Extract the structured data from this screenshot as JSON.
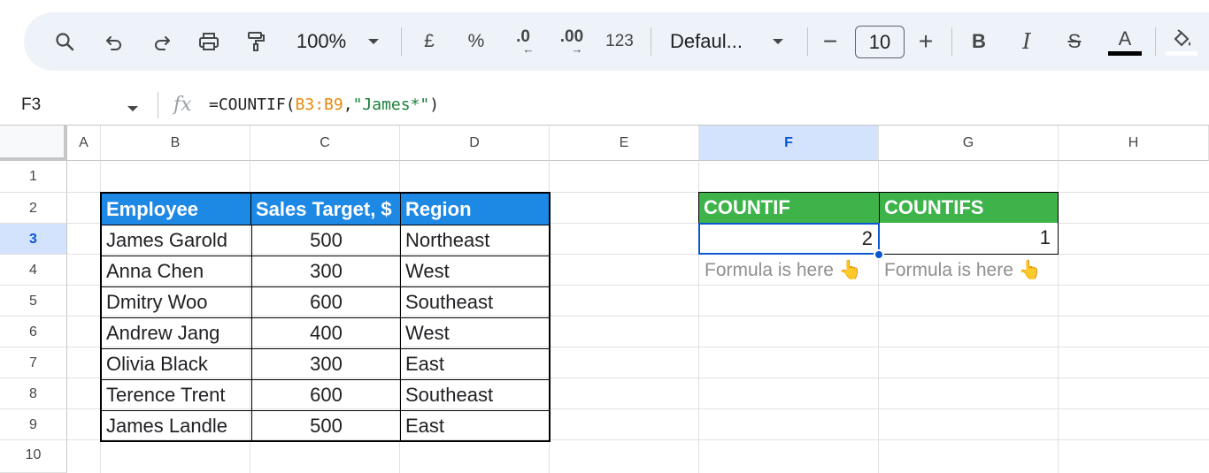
{
  "toolbar": {
    "zoom": "100%",
    "currency": "£",
    "percent": "%",
    "dec_decrease": ".0",
    "dec_increase": ".00",
    "number_format": "123",
    "font": "Defaul...",
    "minus": "−",
    "font_size": "10",
    "plus": "+",
    "bold": "B",
    "italic": "I",
    "strike": "S",
    "text_color": "A",
    "text_color_underline": "#000000"
  },
  "formula_bar": {
    "cell_ref": "F3",
    "fx": "fx",
    "formula_prefix": "=COUNTIF(",
    "formula_range": "B3:B9",
    "formula_comma": ",",
    "formula_string": "\"James*\"",
    "formula_suffix": ")"
  },
  "columns": [
    "A",
    "B",
    "C",
    "D",
    "E",
    "F",
    "G",
    "H"
  ],
  "rows": [
    "1",
    "2",
    "3",
    "4",
    "5",
    "6",
    "7",
    "8",
    "9",
    "10"
  ],
  "selected_column": "F",
  "selected_row": "3",
  "table": {
    "headers": [
      "Employee",
      "Sales Target, $",
      "Region"
    ],
    "rows": [
      [
        "James Garold",
        "500",
        "Northeast"
      ],
      [
        "Anna Chen",
        "300",
        "West"
      ],
      [
        "Dmitry Woo",
        "600",
        "Southeast"
      ],
      [
        "Andrew Jang",
        "400",
        "West"
      ],
      [
        "Olivia Black",
        "300",
        "East"
      ],
      [
        "Terence Trent",
        "600",
        "Southeast"
      ],
      [
        "James Landle",
        "500",
        "East"
      ]
    ],
    "header_color": "#1e88e5"
  },
  "results": {
    "countif_label": "COUNTIF",
    "countifs_label": "COUNTIFS",
    "countif_value": "2",
    "countifs_value": "1",
    "note_f": "Formula is here 👆",
    "note_g": "Formula is here 👆",
    "header_color": "#3db34a"
  },
  "colors": {
    "selection": "#0b57d0",
    "toolbar_bg": "#eef2f9"
  }
}
